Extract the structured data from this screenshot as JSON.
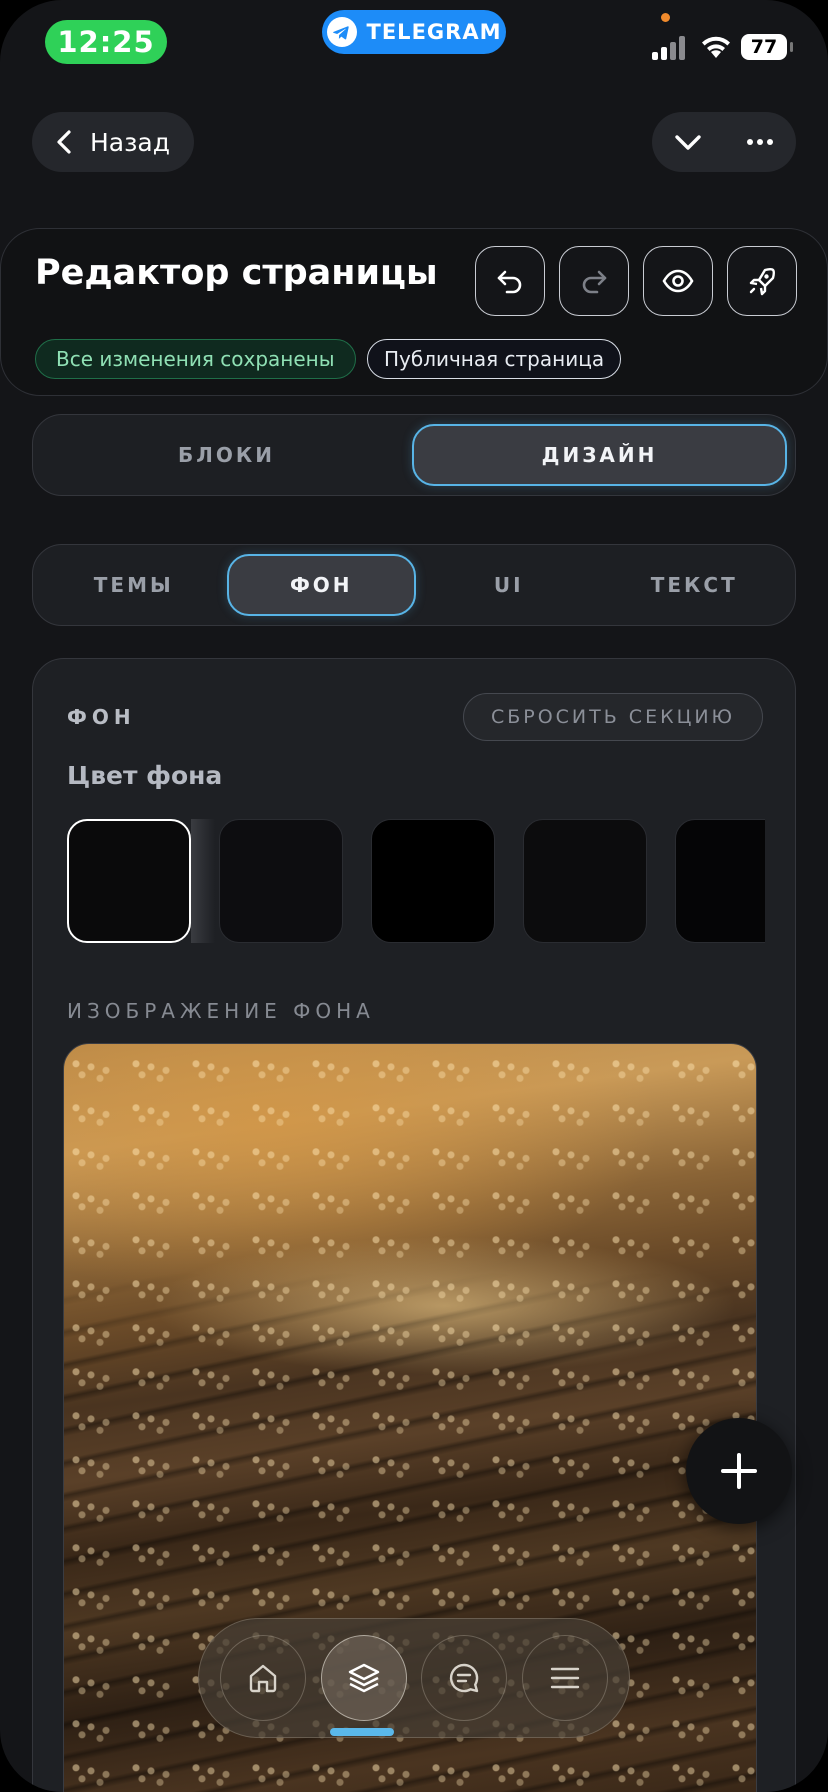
{
  "status_bar": {
    "time": "12:25",
    "app_pill_label": "TELEGRAM",
    "battery": "77",
    "colors": {
      "time_pill": "#2fd158",
      "telegram_pill": "#1d8cf8"
    }
  },
  "nav": {
    "back_label": "Назад",
    "icons": [
      "chevron-left-icon",
      "chevron-down-icon",
      "more-icon"
    ]
  },
  "header": {
    "title": "Редактор страницы",
    "tools": [
      "undo-icon",
      "redo-icon",
      "eye-icon",
      "rocket-icon"
    ],
    "saved_badge": "Все изменения сохранены",
    "visibility_badge": "Публичная страница"
  },
  "mode_tabs": [
    {
      "label": "БЛОКИ",
      "active": false
    },
    {
      "label": "ДИЗАЙН",
      "active": true
    }
  ],
  "design_tabs": [
    {
      "label": "ТЕМЫ",
      "active": false
    },
    {
      "label": "ФОН",
      "active": true
    },
    {
      "label": "UI",
      "active": false
    },
    {
      "label": "ТЕКСТ",
      "active": false
    }
  ],
  "background_section": {
    "section_title": "ФОН",
    "reset_label": "СБРОСИТЬ СЕКЦИЮ",
    "color_label": "Цвет фона",
    "swatches": [
      "#0a0a0b",
      "#0d0d10",
      "#000000",
      "#0c0c0d",
      "#050506"
    ],
    "selected_swatch": 0,
    "image_label": "ИЗОБРАЖЕНИЕ ФОНА"
  },
  "dock": {
    "items": [
      "home-icon",
      "layers-icon",
      "chat-icon",
      "menu-icon"
    ],
    "active_index": 1,
    "accent": "#5ab8ea"
  }
}
